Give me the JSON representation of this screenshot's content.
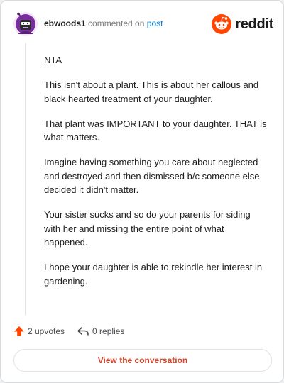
{
  "header": {
    "username": "ebwoods1",
    "commented_on": "commented on",
    "post_link": "post",
    "brand": "reddit"
  },
  "comment": {
    "paragraphs": [
      "NTA",
      "This isn't about a plant. This is about her callous and black hearted treatment of your daughter.",
      "That plant was IMPORTANT to your daughter. THAT is what matters.",
      "Imagine having something you care about neglected and destroyed and then dismissed b/c someone else decided it didn't matter.",
      "Your sister sucks and so do your parents for siding with her and missing the entire point of what happened.",
      "I hope your daughter is able to rekindle her interest in gardening."
    ]
  },
  "actions": {
    "upvotes": "2 upvotes",
    "replies": "0 replies"
  },
  "view_button": "View the conversation",
  "colors": {
    "brand_orange": "#ff4500",
    "upvote_orange": "#ff4500",
    "link_blue": "#0079d3",
    "button_text": "#d6432a",
    "avatar_purple": "#7a2ea0"
  }
}
